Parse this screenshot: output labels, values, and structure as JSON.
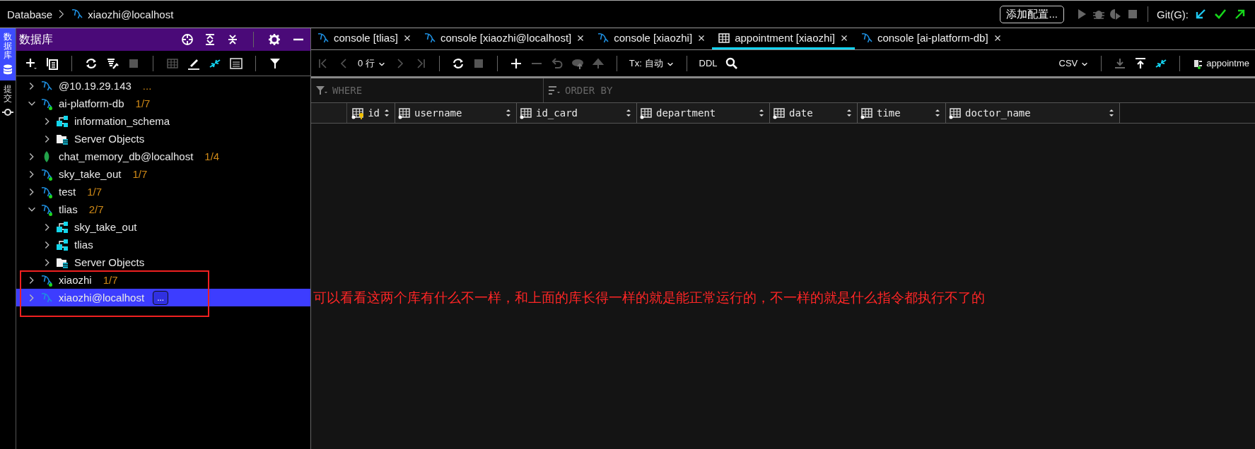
{
  "breadcrumb": {
    "root": "Database",
    "current": "xiaozhi@localhost"
  },
  "run_config": {
    "label": "添加配置..."
  },
  "git": {
    "label": "Git(G):"
  },
  "side_tabs": [
    {
      "label": "数据库",
      "kind": "database",
      "selected": true
    },
    {
      "label": "提交",
      "kind": "commit",
      "selected": false
    }
  ],
  "panel": {
    "title": "数据库"
  },
  "tree": [
    {
      "label": "@10.19.29.143",
      "kind": "mysql",
      "count": "...",
      "connected": false,
      "expanded": false,
      "selected": false
    },
    {
      "label": "ai-platform-db",
      "kind": "mysql",
      "count": "1/7",
      "connected": true,
      "expanded": true,
      "selected": false,
      "children": [
        {
          "label": "information_schema",
          "kind": "schema",
          "expanded": false,
          "selected": false
        },
        {
          "label": "Server Objects",
          "kind": "folder",
          "expanded": false,
          "selected": false
        }
      ]
    },
    {
      "label": "chat_memory_db@localhost",
      "kind": "mongo",
      "count": "1/4",
      "expanded": false,
      "selected": false
    },
    {
      "label": "sky_take_out",
      "kind": "mysql",
      "count": "1/7",
      "connected": true,
      "expanded": false,
      "selected": false
    },
    {
      "label": "test",
      "kind": "mysql",
      "count": "1/7",
      "connected": true,
      "expanded": false,
      "selected": false
    },
    {
      "label": "tlias",
      "kind": "mysql",
      "count": "2/7",
      "connected": true,
      "expanded": true,
      "selected": false,
      "children": [
        {
          "label": "sky_take_out",
          "kind": "schema",
          "expanded": false,
          "selected": false
        },
        {
          "label": "tlias",
          "kind": "schema",
          "expanded": false,
          "selected": false
        },
        {
          "label": "Server Objects",
          "kind": "folder",
          "expanded": false,
          "selected": false
        }
      ]
    },
    {
      "label": "xiaozhi",
      "kind": "mysql",
      "count": "1/7",
      "connected": true,
      "expanded": false,
      "selected": false
    },
    {
      "label": "xiaozhi@localhost",
      "kind": "mysql",
      "more_button": "...",
      "connected": false,
      "expanded": false,
      "selected": true
    }
  ],
  "tabs": [
    {
      "label": "console [tlias]",
      "kind": "console",
      "selected": false
    },
    {
      "label": "console [xiaozhi@localhost]",
      "kind": "console",
      "selected": false
    },
    {
      "label": "console [xiaozhi]",
      "kind": "console",
      "selected": false
    },
    {
      "label": "appointment [xiaozhi]",
      "kind": "table",
      "selected": true
    },
    {
      "label": "console [ai-platform-db]",
      "kind": "console",
      "selected": false
    }
  ],
  "toolbar": {
    "rows": "0 行",
    "tx": "Tx: 自动",
    "ddl": "DDL",
    "format": "CSV",
    "target": "appointme"
  },
  "filters": {
    "where": {
      "placeholder": "WHERE"
    },
    "order_by": {
      "placeholder": "ORDER BY"
    }
  },
  "columns": [
    {
      "name": "id",
      "kind": "key"
    },
    {
      "name": "username",
      "kind": "column"
    },
    {
      "name": "id_card",
      "kind": "column"
    },
    {
      "name": "department",
      "kind": "column"
    },
    {
      "name": "date",
      "kind": "column"
    },
    {
      "name": "time",
      "kind": "column"
    },
    {
      "name": "doctor_name",
      "kind": "column"
    }
  ],
  "annotation": {
    "text": "可以看看这两个库有什么不一样，和上面的库长得一样的就是能正常运行的，不一样的就是什么指令都执行不了的"
  }
}
